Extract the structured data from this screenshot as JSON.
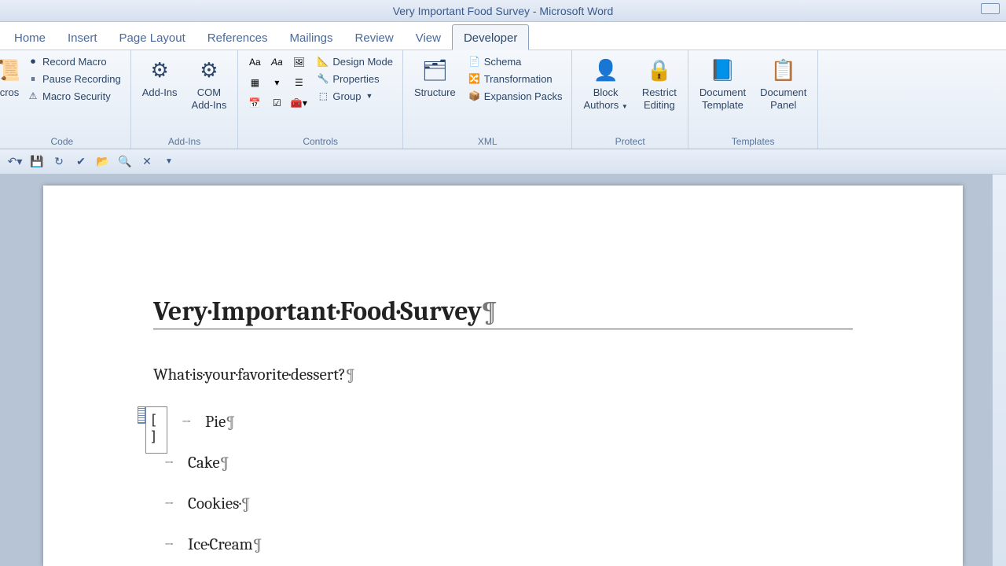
{
  "window": {
    "title": "Very Important Food Survey  -  Microsoft Word"
  },
  "tabs": {
    "home": "Home",
    "insert": "Insert",
    "page_layout": "Page Layout",
    "references": "References",
    "mailings": "Mailings",
    "review": "Review",
    "view": "View",
    "developer": "Developer"
  },
  "ribbon": {
    "code": {
      "label": "Code",
      "visual_basic_partial": "cros",
      "macros_partial": "cros",
      "record_macro": "Record Macro",
      "pause_recording": "Pause Recording",
      "macro_security": "Macro Security"
    },
    "addins": {
      "label": "Add-Ins",
      "addins": "Add-Ins",
      "com_addins_line1": "COM",
      "com_addins_line2": "Add-Ins"
    },
    "controls": {
      "label": "Controls",
      "design_mode": "Design Mode",
      "properties": "Properties",
      "group": "Group"
    },
    "xml": {
      "label": "XML",
      "structure": "Structure",
      "schema": "Schema",
      "transformation": "Transformation",
      "expansion_packs": "Expansion Packs"
    },
    "protect": {
      "label": "Protect",
      "block_authors_line1": "Block",
      "block_authors_line2": "Authors",
      "restrict_line1": "Restrict",
      "restrict_line2": "Editing"
    },
    "templates": {
      "label": "Templates",
      "doc_template_line1": "Document",
      "doc_template_line2": "Template",
      "doc_panel_line1": "Document",
      "doc_panel_line2": "Panel"
    }
  },
  "document": {
    "title_text": "Very·Important·Food·Survey",
    "question_text": "What·is·your·favorite·dessert?",
    "options": [
      "Pie",
      "Cake",
      "Cookies·",
      "Ice·Cream"
    ],
    "control_placeholder": "[ ]"
  }
}
